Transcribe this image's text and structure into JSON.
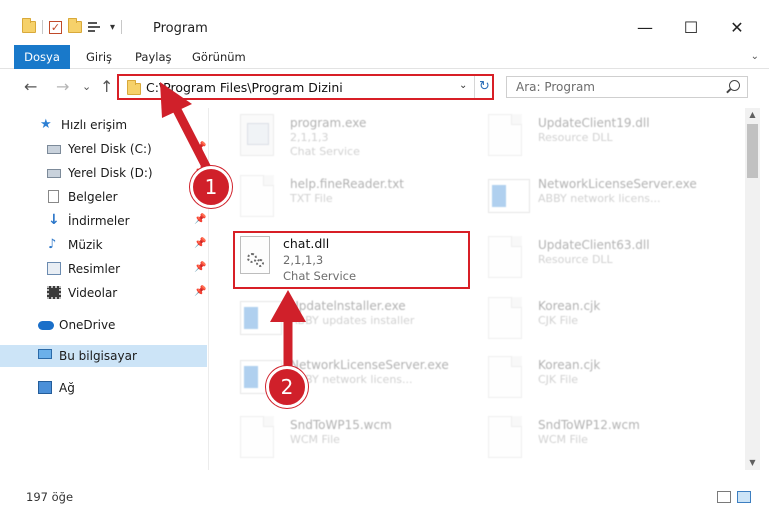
{
  "window": {
    "title": "Program",
    "minimize": "—",
    "maximize": "☐",
    "close": "✕"
  },
  "ribbon": {
    "tabs": [
      "Dosya",
      "Giriş",
      "Paylaş",
      "Görünüm"
    ],
    "expand": "⌄",
    "file_tab_color": "#1979ca"
  },
  "navigation": {
    "back": "←",
    "forward": "→",
    "recent": "⌄",
    "up": "↑"
  },
  "address": {
    "path": "C:\\Program Files\\Program Dizini",
    "dropdown": "⌄",
    "refresh": "↻"
  },
  "search": {
    "placeholder": "Ara: Program"
  },
  "sidebar": {
    "items": [
      {
        "label": "Hızlı erişim",
        "icon": "star-icon",
        "pinned": false
      },
      {
        "label": "Yerel Disk (C:)",
        "icon": "drive-icon",
        "pinned": true
      },
      {
        "label": "Yerel Disk (D:)",
        "icon": "drive-icon",
        "pinned": true
      },
      {
        "label": "Belgeler",
        "icon": "document-icon",
        "pinned": true
      },
      {
        "label": "İndirmeler",
        "icon": "download-icon",
        "pinned": true
      },
      {
        "label": "Müzik",
        "icon": "music-icon",
        "pinned": true
      },
      {
        "label": "Resimler",
        "icon": "pictures-icon",
        "pinned": true
      },
      {
        "label": "Videolar",
        "icon": "video-icon",
        "pinned": true
      },
      {
        "label": "OneDrive",
        "icon": "cloud-icon",
        "pinned": false
      },
      {
        "label": "Bu bilgisayar",
        "icon": "computer-icon",
        "pinned": false,
        "selected": true
      },
      {
        "label": "Ağ",
        "icon": "network-icon",
        "pinned": false
      }
    ],
    "selected_color": "#cce4f7"
  },
  "files": {
    "left": [
      {
        "name": "program.exe",
        "line1": "2,1,1,3",
        "line2": "Chat Service",
        "icon": "app"
      },
      {
        "name": "help.fineReader.txt",
        "line1": "TXT File",
        "line2": "",
        "icon": "doc"
      },
      {
        "name": "Updatelnstaller.exe",
        "line1": "ABBY updates installer",
        "line2": "",
        "icon": "win"
      },
      {
        "name": "NetworkLicenseServer.exe",
        "line1": "ABBY network licens...",
        "line2": "",
        "icon": "win"
      },
      {
        "name": "SndToWP15.wcm",
        "line1": "WCM File",
        "line2": "",
        "icon": "doc"
      }
    ],
    "right": [
      {
        "name": "UpdateClient19.dll",
        "line1": "Resource DLL",
        "line2": "",
        "icon": "doc"
      },
      {
        "name": "NetworkLicenseServer.exe",
        "line1": "ABBY network licens...",
        "line2": "",
        "icon": "win"
      },
      {
        "name": "UpdateClient63.dll",
        "line1": "Resource DLL",
        "line2": "",
        "icon": "doc"
      },
      {
        "name": "Korean.cjk",
        "line1": "CJK File",
        "line2": "",
        "icon": "doc"
      },
      {
        "name": "Korean.cjk",
        "line1": "CJK File",
        "line2": "",
        "icon": "doc"
      },
      {
        "name": "SndToWP12.wcm",
        "line1": "WCM File",
        "line2": "",
        "icon": "doc"
      }
    ],
    "highlighted": {
      "name": "chat.dll",
      "version": "2,1,1,3",
      "description": "Chat Service"
    }
  },
  "status": {
    "count": "197 öğe"
  },
  "annotations": {
    "badge1": "1",
    "badge2": "2",
    "color": "#d0202a"
  }
}
